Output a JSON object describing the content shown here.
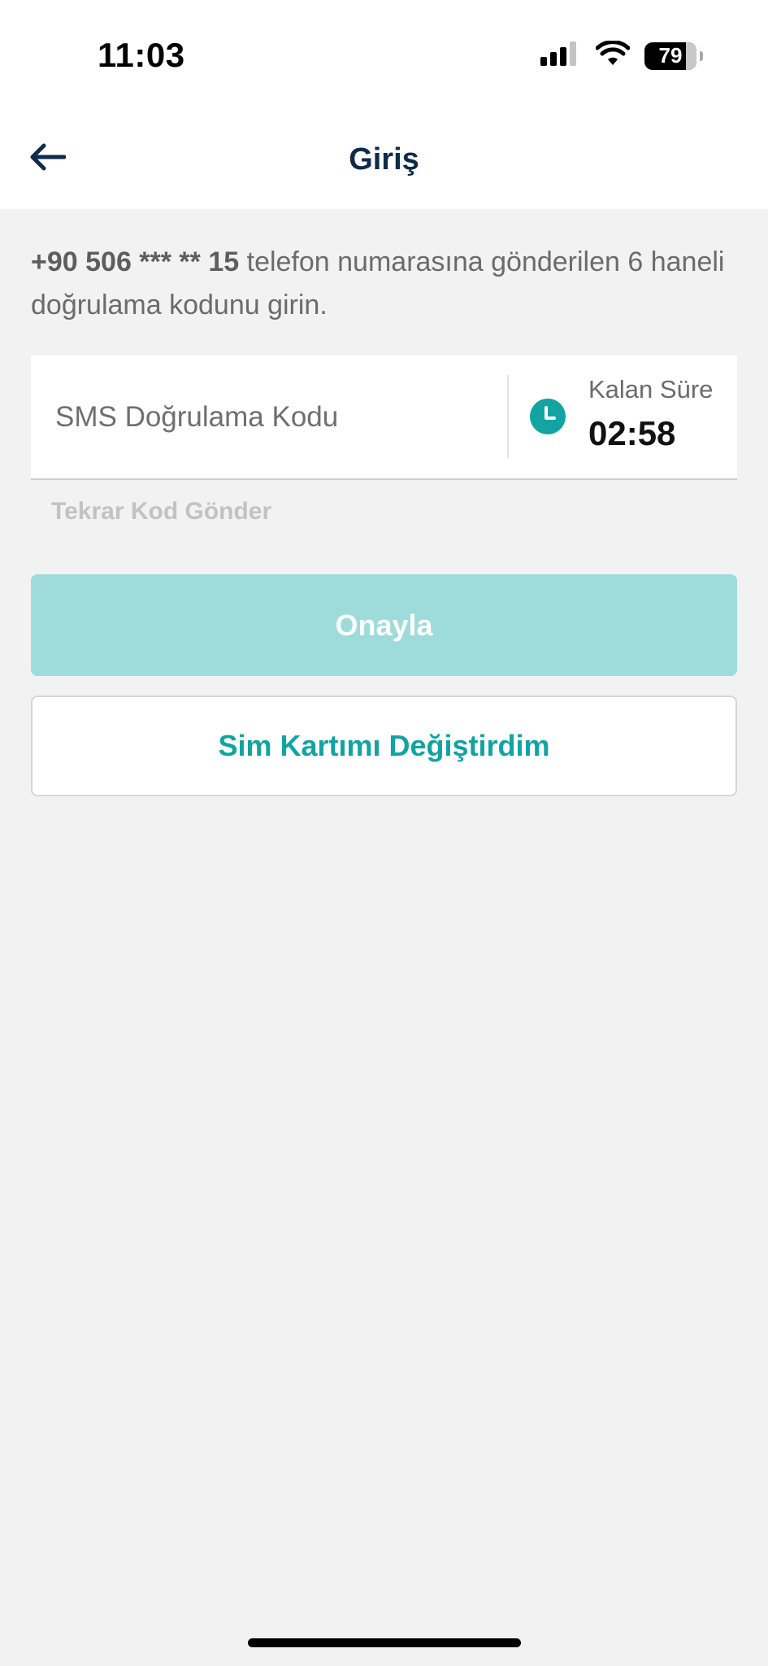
{
  "status_bar": {
    "time": "11:03",
    "battery_percent": "79",
    "battery_level": 0.79
  },
  "header": {
    "title": "Giriş",
    "back_icon": "arrow-left-icon"
  },
  "info": {
    "phone": "+90 506 *** ** 15",
    "message": " telefon numarasına gönderilen 6 haneli doğrulama kodunu girin."
  },
  "sms_field": {
    "placeholder": "SMS Doğrulama Kodu",
    "value": "",
    "timer_label": "Kalan Süre",
    "timer_value": "02:58",
    "timer_icon": "clock-icon"
  },
  "resend_label": "Tekrar Kod Gönder",
  "buttons": {
    "confirm_label": "Onayla",
    "sim_changed_label": "Sim Kartımı Değiştirdim"
  },
  "colors": {
    "accent": "#12a3a3",
    "confirm_disabled": "#9ddcdb",
    "title": "#0f2a4a",
    "background": "#f2f2f2"
  }
}
